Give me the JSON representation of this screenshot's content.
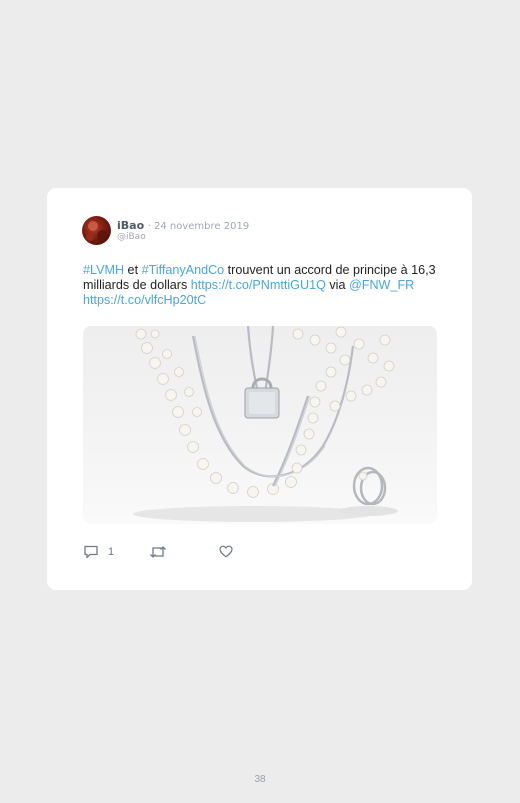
{
  "tweet": {
    "author_name": "iBao",
    "date": "· 24 novembre 2019",
    "handle": "@iBao",
    "text_parts": {
      "tag1": "#LVMH",
      "t1": " et ",
      "tag2": "#TiffanyAndCo",
      "t2": " trouvent un accord de principe à 16,3 milliards de dollars ",
      "link1": "https://t.co/PNmttiGU1Q",
      "t3": " via ",
      "mention": "@FNW_FR",
      "t4": " ",
      "link2": "https://t.co/vlfcHp20tC"
    },
    "reply_count": "1",
    "retweet_count": "",
    "like_count": ""
  },
  "icons": {
    "reply": "reply-icon",
    "retweet": "retweet-icon",
    "like": "heart-icon"
  },
  "colors": {
    "link": "#49a6df",
    "card": "#ffffff",
    "background": "#ececec"
  },
  "page_number": "38"
}
